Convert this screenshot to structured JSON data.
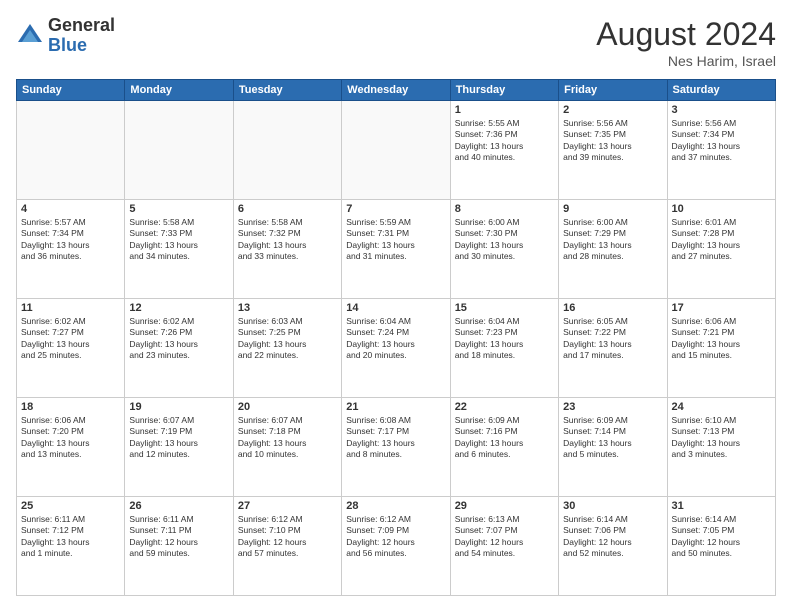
{
  "header": {
    "logo_general": "General",
    "logo_blue": "Blue",
    "month_title": "August 2024",
    "location": "Nes Harim, Israel"
  },
  "days_of_week": [
    "Sunday",
    "Monday",
    "Tuesday",
    "Wednesday",
    "Thursday",
    "Friday",
    "Saturday"
  ],
  "weeks": [
    [
      {
        "day": "",
        "info": ""
      },
      {
        "day": "",
        "info": ""
      },
      {
        "day": "",
        "info": ""
      },
      {
        "day": "",
        "info": ""
      },
      {
        "day": "1",
        "info": "Sunrise: 5:55 AM\nSunset: 7:36 PM\nDaylight: 13 hours\nand 40 minutes."
      },
      {
        "day": "2",
        "info": "Sunrise: 5:56 AM\nSunset: 7:35 PM\nDaylight: 13 hours\nand 39 minutes."
      },
      {
        "day": "3",
        "info": "Sunrise: 5:56 AM\nSunset: 7:34 PM\nDaylight: 13 hours\nand 37 minutes."
      }
    ],
    [
      {
        "day": "4",
        "info": "Sunrise: 5:57 AM\nSunset: 7:34 PM\nDaylight: 13 hours\nand 36 minutes."
      },
      {
        "day": "5",
        "info": "Sunrise: 5:58 AM\nSunset: 7:33 PM\nDaylight: 13 hours\nand 34 minutes."
      },
      {
        "day": "6",
        "info": "Sunrise: 5:58 AM\nSunset: 7:32 PM\nDaylight: 13 hours\nand 33 minutes."
      },
      {
        "day": "7",
        "info": "Sunrise: 5:59 AM\nSunset: 7:31 PM\nDaylight: 13 hours\nand 31 minutes."
      },
      {
        "day": "8",
        "info": "Sunrise: 6:00 AM\nSunset: 7:30 PM\nDaylight: 13 hours\nand 30 minutes."
      },
      {
        "day": "9",
        "info": "Sunrise: 6:00 AM\nSunset: 7:29 PM\nDaylight: 13 hours\nand 28 minutes."
      },
      {
        "day": "10",
        "info": "Sunrise: 6:01 AM\nSunset: 7:28 PM\nDaylight: 13 hours\nand 27 minutes."
      }
    ],
    [
      {
        "day": "11",
        "info": "Sunrise: 6:02 AM\nSunset: 7:27 PM\nDaylight: 13 hours\nand 25 minutes."
      },
      {
        "day": "12",
        "info": "Sunrise: 6:02 AM\nSunset: 7:26 PM\nDaylight: 13 hours\nand 23 minutes."
      },
      {
        "day": "13",
        "info": "Sunrise: 6:03 AM\nSunset: 7:25 PM\nDaylight: 13 hours\nand 22 minutes."
      },
      {
        "day": "14",
        "info": "Sunrise: 6:04 AM\nSunset: 7:24 PM\nDaylight: 13 hours\nand 20 minutes."
      },
      {
        "day": "15",
        "info": "Sunrise: 6:04 AM\nSunset: 7:23 PM\nDaylight: 13 hours\nand 18 minutes."
      },
      {
        "day": "16",
        "info": "Sunrise: 6:05 AM\nSunset: 7:22 PM\nDaylight: 13 hours\nand 17 minutes."
      },
      {
        "day": "17",
        "info": "Sunrise: 6:06 AM\nSunset: 7:21 PM\nDaylight: 13 hours\nand 15 minutes."
      }
    ],
    [
      {
        "day": "18",
        "info": "Sunrise: 6:06 AM\nSunset: 7:20 PM\nDaylight: 13 hours\nand 13 minutes."
      },
      {
        "day": "19",
        "info": "Sunrise: 6:07 AM\nSunset: 7:19 PM\nDaylight: 13 hours\nand 12 minutes."
      },
      {
        "day": "20",
        "info": "Sunrise: 6:07 AM\nSunset: 7:18 PM\nDaylight: 13 hours\nand 10 minutes."
      },
      {
        "day": "21",
        "info": "Sunrise: 6:08 AM\nSunset: 7:17 PM\nDaylight: 13 hours\nand 8 minutes."
      },
      {
        "day": "22",
        "info": "Sunrise: 6:09 AM\nSunset: 7:16 PM\nDaylight: 13 hours\nand 6 minutes."
      },
      {
        "day": "23",
        "info": "Sunrise: 6:09 AM\nSunset: 7:14 PM\nDaylight: 13 hours\nand 5 minutes."
      },
      {
        "day": "24",
        "info": "Sunrise: 6:10 AM\nSunset: 7:13 PM\nDaylight: 13 hours\nand 3 minutes."
      }
    ],
    [
      {
        "day": "25",
        "info": "Sunrise: 6:11 AM\nSunset: 7:12 PM\nDaylight: 13 hours\nand 1 minute."
      },
      {
        "day": "26",
        "info": "Sunrise: 6:11 AM\nSunset: 7:11 PM\nDaylight: 12 hours\nand 59 minutes."
      },
      {
        "day": "27",
        "info": "Sunrise: 6:12 AM\nSunset: 7:10 PM\nDaylight: 12 hours\nand 57 minutes."
      },
      {
        "day": "28",
        "info": "Sunrise: 6:12 AM\nSunset: 7:09 PM\nDaylight: 12 hours\nand 56 minutes."
      },
      {
        "day": "29",
        "info": "Sunrise: 6:13 AM\nSunset: 7:07 PM\nDaylight: 12 hours\nand 54 minutes."
      },
      {
        "day": "30",
        "info": "Sunrise: 6:14 AM\nSunset: 7:06 PM\nDaylight: 12 hours\nand 52 minutes."
      },
      {
        "day": "31",
        "info": "Sunrise: 6:14 AM\nSunset: 7:05 PM\nDaylight: 12 hours\nand 50 minutes."
      }
    ]
  ]
}
